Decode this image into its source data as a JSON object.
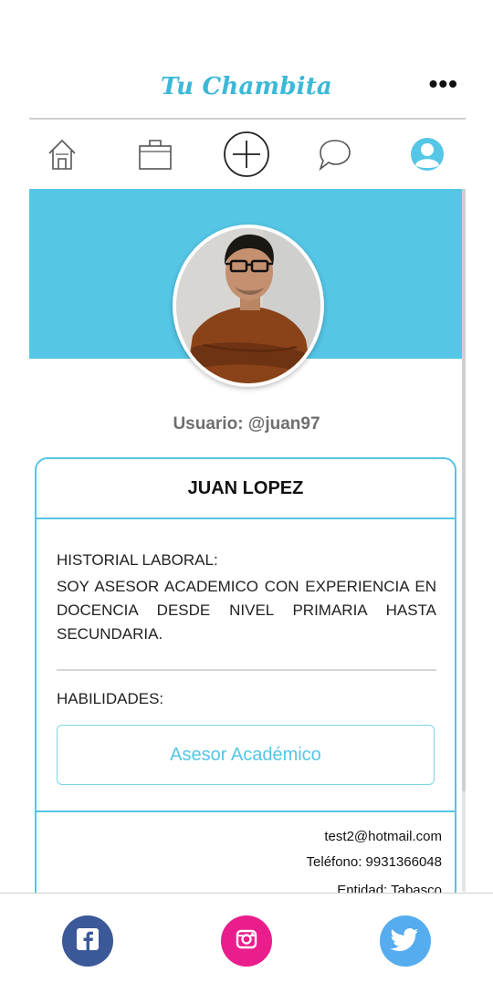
{
  "header": {
    "app_title": "Tu Chambita",
    "menu_icon": "more-horizontal-icon",
    "menu_text": "•••"
  },
  "nav": {
    "items": [
      {
        "icon": "home-icon"
      },
      {
        "icon": "briefcase-icon"
      },
      {
        "icon": "add-circle-icon"
      },
      {
        "icon": "chat-icon"
      },
      {
        "icon": "user-profile-icon",
        "active": true
      }
    ]
  },
  "profile": {
    "username": "Usuario: @juan97",
    "name": "JUAN LOPEZ",
    "history_label": "HISTORIAL LABORAL:",
    "history_text": "SOY ASESOR ACADEMICO CON EXPERIENCIA EN DOCENCIA DESDE NIVEL PRIMARIA HASTA SECUNDARIA.",
    "skills_label": "HABILIDADES:",
    "skills": [
      "Asesor Académico"
    ],
    "email": "test2@hotmail.com",
    "phone": "Teléfono: 9931366048",
    "state": "Entidad: Tabasco"
  },
  "footer": {
    "social": [
      {
        "icon": "facebook-icon",
        "color": "#3b5998"
      },
      {
        "icon": "instagram-icon",
        "color": "#e91e8c"
      },
      {
        "icon": "twitter-icon",
        "color": "#55acee"
      }
    ]
  },
  "colors": {
    "accent": "#55c6e6",
    "title": "#3cb8d8"
  }
}
